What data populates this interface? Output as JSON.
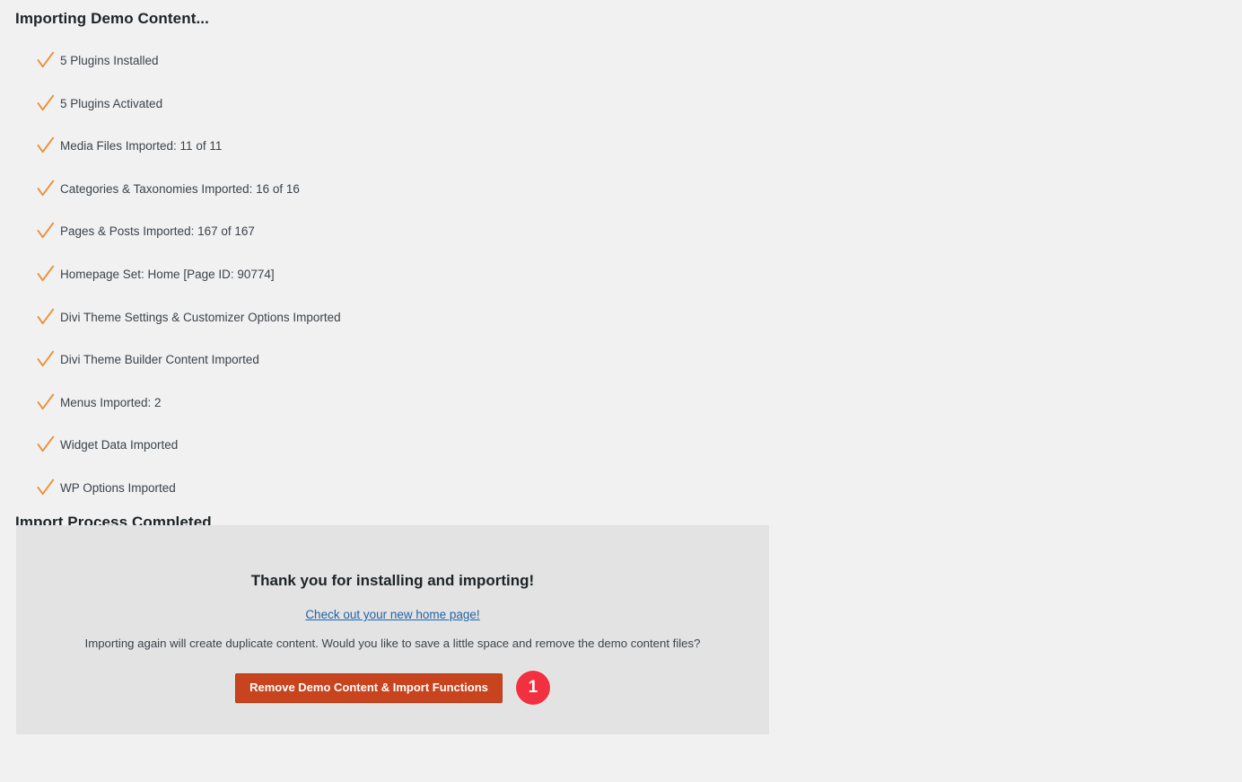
{
  "headings": {
    "importing": "Importing Demo Content...",
    "completed": "Import Process Completed"
  },
  "progress_items": [
    {
      "label": "5 Plugins Installed",
      "icon": "check-icon"
    },
    {
      "label": "5 Plugins Activated",
      "icon": "check-icon"
    },
    {
      "label": "Media Files Imported: 11 of 11",
      "icon": "check-icon"
    },
    {
      "label": "Categories & Taxonomies Imported: 16 of 16",
      "icon": "check-icon"
    },
    {
      "label": "Pages & Posts Imported: 167 of 167",
      "icon": "check-icon"
    },
    {
      "label": "Homepage Set: Home [Page ID: 90774]",
      "icon": "check-icon"
    },
    {
      "label": "Divi Theme Settings & Customizer Options Imported",
      "icon": "check-icon"
    },
    {
      "label": "Divi Theme Builder Content Imported",
      "icon": "check-icon"
    },
    {
      "label": "Menus Imported: 2",
      "icon": "check-icon"
    },
    {
      "label": "Widget Data Imported",
      "icon": "check-icon"
    },
    {
      "label": "WP Options Imported",
      "icon": "check-icon"
    }
  ],
  "panel": {
    "title": "Thank you for installing and importing!",
    "link_text": "Check out your new home page!",
    "description": "Importing again will create duplicate content. Would you like to save a little space and remove the demo content files?",
    "button_label": "Remove Demo Content & Import Functions",
    "step_badge": "1"
  },
  "colors": {
    "page_background": "#f1f1f1",
    "panel_background": "#e3e3e3",
    "checkmark": "#e8913a",
    "button_background": "#c8441e",
    "badge_background": "#f2303f",
    "link": "#2064a8",
    "heading_text": "#1d2327",
    "body_text": "#3c434a"
  }
}
